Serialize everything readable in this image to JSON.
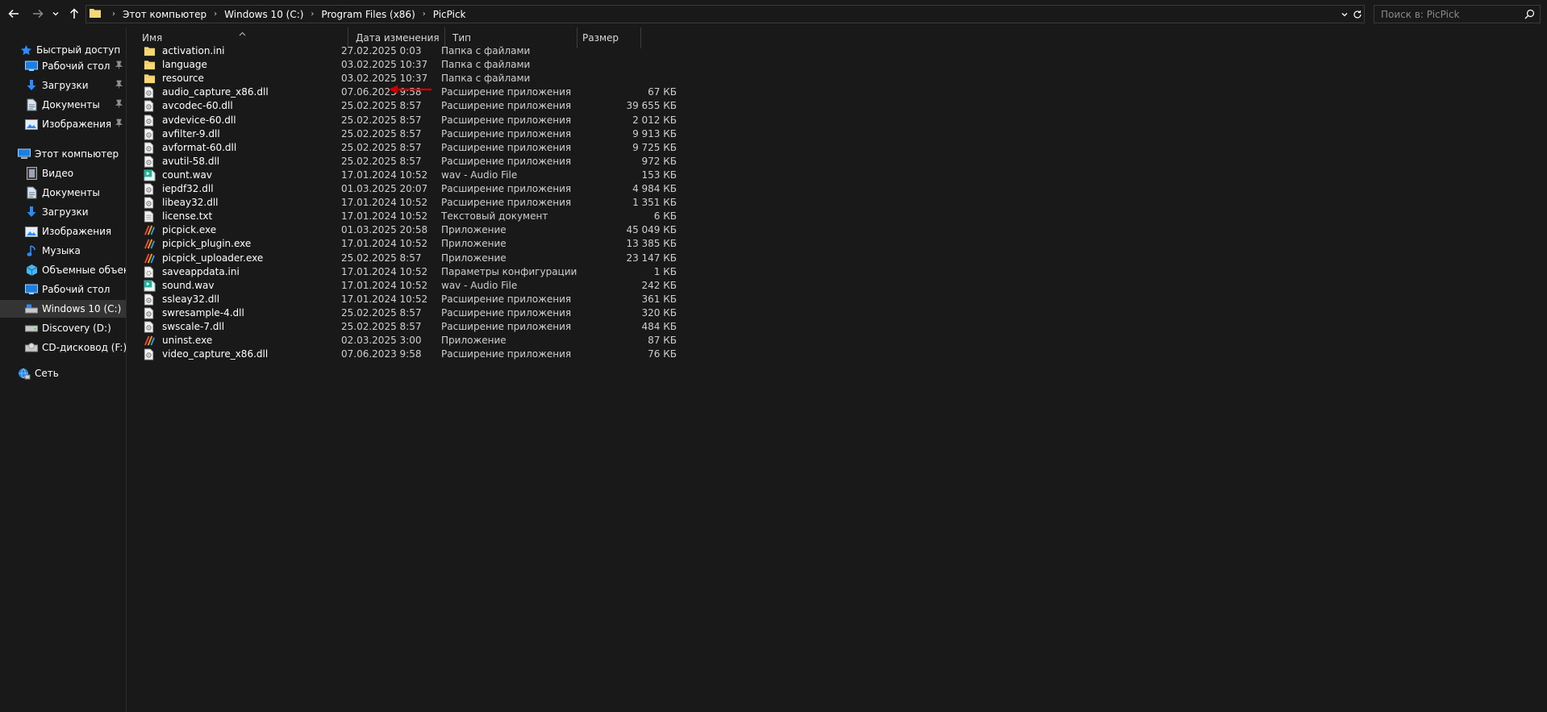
{
  "address_bar": {
    "breadcrumbs": [
      "Этот компьютер",
      "Windows 10 (C:)",
      "Program Files (x86)",
      "PicPick"
    ]
  },
  "search": {
    "placeholder": "Поиск в: PicPick"
  },
  "sidebar": {
    "quick_access": {
      "label": "Быстрый доступ",
      "items": [
        {
          "label": "Рабочий стол",
          "icon": "desktop-icon"
        },
        {
          "label": "Загрузки",
          "icon": "download-icon"
        },
        {
          "label": "Документы",
          "icon": "documents-icon"
        },
        {
          "label": "Изображения",
          "icon": "pictures-icon"
        }
      ]
    },
    "this_pc": {
      "label": "Этот компьютер",
      "items": [
        {
          "label": "Видео",
          "icon": "video-icon"
        },
        {
          "label": "Документы",
          "icon": "documents-icon"
        },
        {
          "label": "Загрузки",
          "icon": "download-icon"
        },
        {
          "label": "Изображения",
          "icon": "pictures-icon"
        },
        {
          "label": "Музыка",
          "icon": "music-icon"
        },
        {
          "label": "Объемные объекты",
          "icon": "3d-objects-icon"
        },
        {
          "label": "Рабочий стол",
          "icon": "desktop-icon"
        },
        {
          "label": "Windows 10 (C:)",
          "icon": "drive-icon"
        },
        {
          "label": "Discovery (D:)",
          "icon": "drive-icon"
        },
        {
          "label": "CD-дисковод (F:)",
          "icon": "cd-drive-icon"
        }
      ]
    },
    "network": {
      "label": "Сеть"
    }
  },
  "columns": {
    "name": "Имя",
    "date": "Дата изменения",
    "type": "Тип",
    "size": "Размер"
  },
  "files": [
    {
      "name": "activation.ini",
      "date": "27.02.2025 0:03",
      "type": "Папка с файлами",
      "size": "",
      "icon": "folder-icon"
    },
    {
      "name": "language",
      "date": "03.02.2025 10:37",
      "type": "Папка с файлами",
      "size": "",
      "icon": "folder-icon"
    },
    {
      "name": "resource",
      "date": "03.02.2025 10:37",
      "type": "Папка с файлами",
      "size": "",
      "icon": "folder-icon"
    },
    {
      "name": "audio_capture_x86.dll",
      "date": "07.06.2023 9:58",
      "type": "Расширение приложения",
      "size": "67 КБ",
      "icon": "dll-icon"
    },
    {
      "name": "avcodec-60.dll",
      "date": "25.02.2025 8:57",
      "type": "Расширение приложения",
      "size": "39 655 КБ",
      "icon": "dll-icon"
    },
    {
      "name": "avdevice-60.dll",
      "date": "25.02.2025 8:57",
      "type": "Расширение приложения",
      "size": "2 012 КБ",
      "icon": "dll-icon"
    },
    {
      "name": "avfilter-9.dll",
      "date": "25.02.2025 8:57",
      "type": "Расширение приложения",
      "size": "9 913 КБ",
      "icon": "dll-icon"
    },
    {
      "name": "avformat-60.dll",
      "date": "25.02.2025 8:57",
      "type": "Расширение приложения",
      "size": "9 725 КБ",
      "icon": "dll-icon"
    },
    {
      "name": "avutil-58.dll",
      "date": "25.02.2025 8:57",
      "type": "Расширение приложения",
      "size": "972 КБ",
      "icon": "dll-icon"
    },
    {
      "name": "count.wav",
      "date": "17.01.2024 10:52",
      "type": "wav - Audio File",
      "size": "153 КБ",
      "icon": "audio-file-icon"
    },
    {
      "name": "iepdf32.dll",
      "date": "01.03.2025 20:07",
      "type": "Расширение приложения",
      "size": "4 984 КБ",
      "icon": "dll-icon"
    },
    {
      "name": "libeay32.dll",
      "date": "17.01.2024 10:52",
      "type": "Расширение приложения",
      "size": "1 351 КБ",
      "icon": "dll-icon"
    },
    {
      "name": "license.txt",
      "date": "17.01.2024 10:52",
      "type": "Текстовый документ",
      "size": "6 КБ",
      "icon": "text-file-icon"
    },
    {
      "name": "picpick.exe",
      "date": "01.03.2025 20:58",
      "type": "Приложение",
      "size": "45 049 КБ",
      "icon": "picpick-app-icon"
    },
    {
      "name": "picpick_plugin.exe",
      "date": "17.01.2024 10:52",
      "type": "Приложение",
      "size": "13 385 КБ",
      "icon": "picpick-app-icon"
    },
    {
      "name": "picpick_uploader.exe",
      "date": "25.02.2025 8:57",
      "type": "Приложение",
      "size": "23 147 КБ",
      "icon": "picpick-app-icon"
    },
    {
      "name": "saveappdata.ini",
      "date": "17.01.2024 10:52",
      "type": "Параметры конфигурации",
      "size": "1 КБ",
      "icon": "config-file-icon"
    },
    {
      "name": "sound.wav",
      "date": "17.01.2024 10:52",
      "type": "wav - Audio File",
      "size": "242 КБ",
      "icon": "audio-file-icon"
    },
    {
      "name": "ssleay32.dll",
      "date": "17.01.2024 10:52",
      "type": "Расширение приложения",
      "size": "361 КБ",
      "icon": "dll-icon"
    },
    {
      "name": "swresample-4.dll",
      "date": "25.02.2025 8:57",
      "type": "Расширение приложения",
      "size": "320 КБ",
      "icon": "dll-icon"
    },
    {
      "name": "swscale-7.dll",
      "date": "25.02.2025 8:57",
      "type": "Расширение приложения",
      "size": "484 КБ",
      "icon": "dll-icon"
    },
    {
      "name": "uninst.exe",
      "date": "02.03.2025 3:00",
      "type": "Приложение",
      "size": "87 КБ",
      "icon": "picpick-app-icon"
    },
    {
      "name": "video_capture_x86.dll",
      "date": "07.06.2023 9:58",
      "type": "Расширение приложения",
      "size": "76 КБ",
      "icon": "dll-icon"
    }
  ],
  "colors": {
    "background": "#191919",
    "folder": "#f8d775",
    "selection": "#343434",
    "annotation_arrow": "#cc0000"
  }
}
